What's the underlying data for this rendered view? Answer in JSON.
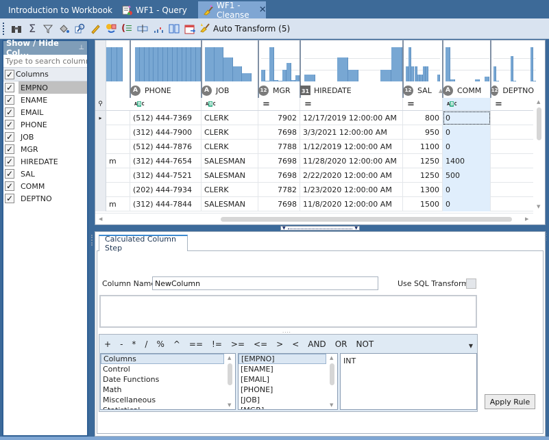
{
  "tabs": [
    {
      "label": "Introduction to Workbook",
      "active": false,
      "icon": "none"
    },
    {
      "label": "WF1 - Query",
      "active": false,
      "icon": "query-icon"
    },
    {
      "label": "WF1 - Cleanse",
      "active": true,
      "icon": "broom-icon",
      "close": "✕"
    }
  ],
  "toolbar": {
    "buttons": [
      "binoculars-icon",
      "sigma-icon",
      "filter-icon",
      "paint-bucket-icon",
      "find-replace-icon",
      "pencil-icon",
      "swap-icon",
      "parentheses-list-icon",
      "textbox-icon",
      "bar-small-icon",
      "split-columns-icon",
      "calendar-icon"
    ],
    "auto_transform": "Auto Transform (5)"
  },
  "left_panel": {
    "title": "Show / Hide Col...",
    "pin": "⊥",
    "search_placeholder": "Type to search columns",
    "header_label": "Columns",
    "items": [
      {
        "label": "EMPNO",
        "checked": true,
        "selected": true
      },
      {
        "label": "ENAME",
        "checked": true
      },
      {
        "label": "EMAIL",
        "checked": true
      },
      {
        "label": "PHONE",
        "checked": true
      },
      {
        "label": "JOB",
        "checked": true
      },
      {
        "label": "MGR",
        "checked": true
      },
      {
        "label": "HIREDATE",
        "checked": true
      },
      {
        "label": "SAL",
        "checked": true
      },
      {
        "label": "COMM",
        "checked": true
      },
      {
        "label": "DEPTNO",
        "checked": true
      }
    ]
  },
  "grid": {
    "columns": [
      {
        "name": "",
        "type": ""
      },
      {
        "name": "PHONE",
        "type": "A",
        "filter": "abc"
      },
      {
        "name": "JOB",
        "type": "A",
        "filter": "abc"
      },
      {
        "name": "MGR",
        "type": "12",
        "filter": "="
      },
      {
        "name": "HIREDATE",
        "type": "31",
        "filter": "="
      },
      {
        "name": "SAL",
        "type": "12",
        "filter": "=",
        "sorted": "asc"
      },
      {
        "name": "COMM",
        "type": "A",
        "filter": "abc"
      },
      {
        "name": "DEPTNO",
        "type": "12",
        "filter": "="
      }
    ],
    "rows": [
      [
        "",
        "(512) 444-7369",
        "CLERK",
        "7902",
        "12/17/2019 12:00:00 AM",
        "800",
        "0",
        ""
      ],
      [
        "",
        "(312) 444-7900",
        "CLERK",
        "7698",
        "3/3/2021 12:00:00 AM",
        "950",
        "0",
        ""
      ],
      [
        "",
        "(512) 444-7876",
        "CLERK",
        "7788",
        "1/12/2019 12:00:00 AM",
        "1100",
        "0",
        ""
      ],
      [
        "m",
        "(312) 444-7654",
        "SALESMAN",
        "7698",
        "11/28/2020 12:00:00 AM",
        "1250",
        "1400",
        ""
      ],
      [
        "",
        "(312) 444-7521",
        "SALESMAN",
        "7698",
        "2/22/2020 12:00:00 AM",
        "1250",
        "500",
        ""
      ],
      [
        "",
        "(202) 444-7934",
        "CLERK",
        "7782",
        "1/23/2020 12:00:00 AM",
        "1300",
        "0",
        ""
      ],
      [
        "m",
        "(312) 444-7844",
        "SALESMAN",
        "7698",
        "11/8/2020 12:00:00 AM",
        "1500",
        "0",
        ""
      ]
    ],
    "current_row_marker": "▸",
    "filter_row_icon": "pin-icon",
    "histograms": {
      "partial": [
        1,
        1,
        1
      ],
      "PHONE": [
        1,
        1,
        1,
        1,
        1,
        1,
        1,
        1,
        1,
        1,
        1,
        1,
        1,
        1
      ],
      "JOB": [
        1,
        1,
        0.7,
        0.45,
        0.25
      ],
      "MGR": [
        0.35,
        0.03,
        1,
        0.05,
        0.03,
        0.35,
        0.55,
        0.05,
        0.18
      ],
      "HIREDATE": [
        0.2,
        0,
        0,
        0.7,
        0.35,
        0,
        0,
        0.35,
        1
      ],
      "SAL": [
        0.45,
        1,
        0.45,
        0.45,
        0.2,
        0.2,
        0.45,
        0.45,
        0,
        0,
        0,
        0.2
      ],
      "COMM": [
        1,
        0.07,
        0,
        0,
        0,
        0,
        0.07,
        0,
        0.15
      ],
      "DEPTNO": [
        0.45,
        0.02,
        0,
        0,
        0,
        0,
        0.75,
        0.02,
        0,
        0,
        0,
        0,
        0,
        1,
        0.02
      ]
    }
  },
  "step": {
    "tab_label": "Calculated Column Step",
    "column_name_label": "Column Name",
    "column_name_value": "NewColumn",
    "sql_label": "Use SQL Transforms",
    "sql_checked": false,
    "expression": "",
    "operators": [
      "+",
      "-",
      "*",
      "/",
      "%",
      "^",
      "==",
      "!=",
      ">=",
      "<=",
      ">",
      "<",
      "AND",
      "OR",
      "NOT"
    ],
    "categories": [
      "Columns",
      "Control",
      "Date Functions",
      "Math",
      "Miscellaneous",
      "Statistical"
    ],
    "fields": [
      "[EMPNO]",
      "[ENAME]",
      "[EMAIL]",
      "[PHONE]",
      "[JOB]",
      "[MGR]"
    ],
    "description": "INT",
    "apply_label": "Apply Rule"
  }
}
